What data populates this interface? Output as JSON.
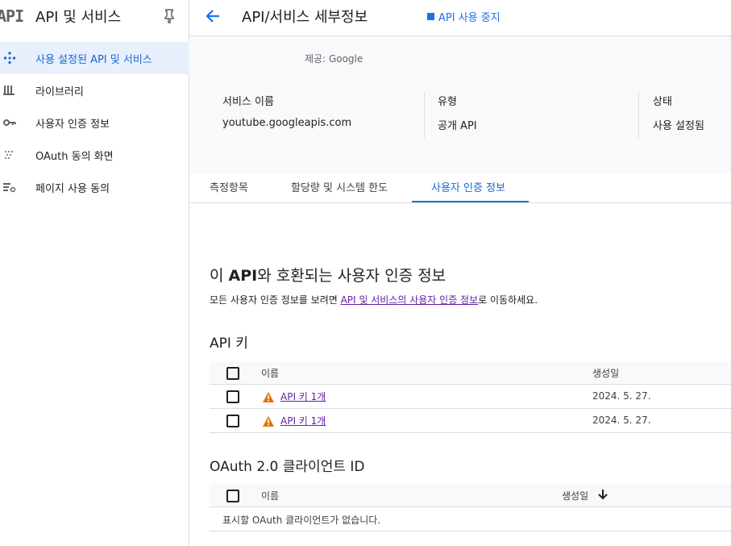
{
  "sidebar": {
    "logo": "API",
    "title": "API 및 서비스",
    "items": [
      {
        "label": "사용 설정된 API 및 서비스",
        "icon": "diamond-dots-icon",
        "active": true
      },
      {
        "label": "라이브러리",
        "icon": "library-icon"
      },
      {
        "label": "사용자 인증 정보",
        "icon": "key-icon"
      },
      {
        "label": "OAuth 동의 화면",
        "icon": "dotted-grid-icon"
      },
      {
        "label": "페이지 사용 동의",
        "icon": "settings-list-icon"
      }
    ]
  },
  "header": {
    "title": "API/서비스 세부정보",
    "disable_label": "API 사용 중지"
  },
  "info": {
    "provider": "제공: Google",
    "service_name_label": "서비스 이름",
    "service_name": "youtube.googleapis.com",
    "type_label": "유형",
    "type": "공개 API",
    "status_label": "상태",
    "status": "사용 설정됨"
  },
  "tabs": [
    "측정항목",
    "할당량 및 시스템 한도",
    "사용자 인증 정보"
  ],
  "content": {
    "title_prefix": "이 ",
    "title_bold": "API",
    "title_suffix": "와 호환되는 사용자 인증 정보",
    "desc_prefix": "모든 사용자 인증 정보를 보려면 ",
    "desc_link": "API 및 서비스의 사용자 인증 정보",
    "desc_suffix": "로 이동하세요.",
    "api_keys": {
      "title": "API 키",
      "col_name": "이름",
      "col_created": "생성일",
      "rows": [
        {
          "name": "API 키 1개",
          "created": "2024. 5. 27."
        },
        {
          "name": "API 키 1개",
          "created": "2024. 5. 27."
        }
      ]
    },
    "oauth": {
      "title": "OAuth 2.0 클라이언트 ID",
      "col_name": "이름",
      "col_created": "생성일",
      "empty": "표시할 OAuth 클라이언트가 없습니다."
    }
  },
  "colors": {
    "accent": "#1a73e8",
    "link_visited": "#681da8",
    "warning": "#e37400"
  }
}
